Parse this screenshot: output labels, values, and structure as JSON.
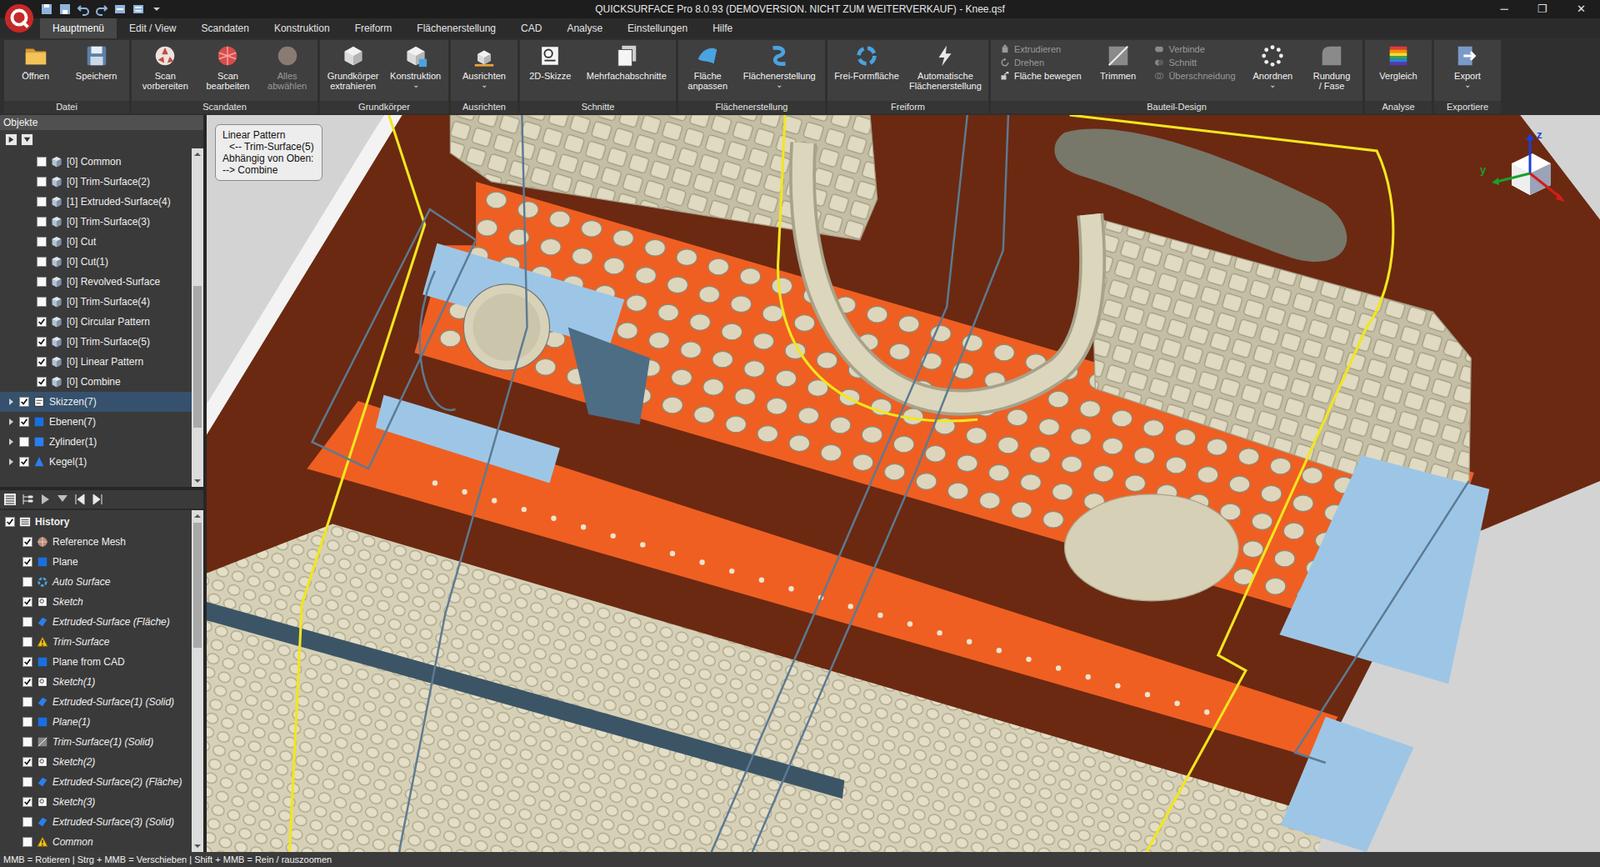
{
  "window": {
    "title": "QUICKSURFACE Pro 8.0.93 (DEMOVERSION. NICHT ZUM WEITERVERKAUF) - Knee.qsf",
    "controls": [
      "─",
      "❐",
      "✕"
    ]
  },
  "menu": [
    {
      "label": "Hauptmenü",
      "selected": true
    },
    {
      "label": "Edit / View",
      "selected": false
    },
    {
      "label": "Scandaten",
      "selected": false
    },
    {
      "label": "Konstruktion",
      "selected": false
    },
    {
      "label": "Freiform",
      "selected": false
    },
    {
      "label": "Flächenerstellung",
      "selected": false
    },
    {
      "label": "CAD",
      "selected": false
    },
    {
      "label": "Analyse",
      "selected": false
    },
    {
      "label": "Einstellungen",
      "selected": false
    },
    {
      "label": "Hilfe",
      "selected": false
    }
  ],
  "ribbon": [
    {
      "label": "Datei",
      "items": [
        {
          "kind": "large",
          "label": [
            "Öffnen"
          ],
          "disabled": false
        },
        {
          "kind": "large",
          "label": [
            "Speichern"
          ],
          "disabled": false
        }
      ]
    },
    {
      "label": "Scandaten",
      "items": [
        {
          "kind": "large",
          "label": [
            "Scan",
            "vorbereiten"
          ],
          "disabled": false
        },
        {
          "kind": "large",
          "label": [
            "Scan",
            "bearbeiten"
          ],
          "disabled": false
        },
        {
          "kind": "large",
          "label": [
            "Alles",
            "abwählen"
          ],
          "disabled": true
        }
      ]
    },
    {
      "label": "Grundkörper",
      "items": [
        {
          "kind": "large",
          "label": [
            "Grundkörper",
            "extrahieren"
          ],
          "disabled": false
        },
        {
          "kind": "large",
          "label": [
            "Konstruktion"
          ],
          "disabled": false,
          "arrow": "⌄"
        }
      ]
    },
    {
      "label": "Ausrichten",
      "items": [
        {
          "kind": "large",
          "label": [
            "Ausrichten"
          ],
          "disabled": false,
          "arrow": "⌄"
        }
      ]
    },
    {
      "label": "Schnitte",
      "items": [
        {
          "kind": "large",
          "label": [
            "2D-Skizze"
          ],
          "disabled": false
        },
        {
          "kind": "large",
          "label": [
            "Mehrfachabschnitte"
          ],
          "disabled": false
        }
      ]
    },
    {
      "label": "Flächenerstellung",
      "items": [
        {
          "kind": "large",
          "label": [
            "Fläche",
            "anpassen"
          ],
          "disabled": false
        },
        {
          "kind": "large",
          "label": [
            "Flächenerstellung"
          ],
          "disabled": false,
          "arrow": "⌄"
        }
      ]
    },
    {
      "label": "Freiform",
      "items": [
        {
          "kind": "large",
          "label": [
            "Frei-Formfläche"
          ],
          "disabled": false
        },
        {
          "kind": "large",
          "label": [
            "Automatische",
            "Flächenerstellung"
          ],
          "disabled": false
        }
      ]
    },
    {
      "label": "Bauteil-Design",
      "items": [
        {
          "kind": "stack",
          "items": [
            {
              "label": "Extrudieren",
              "disabled": true
            },
            {
              "label": "Drehen",
              "disabled": true
            },
            {
              "label": "Fläche bewegen",
              "disabled": false
            }
          ]
        },
        {
          "kind": "large",
          "label": [
            "Trimmen"
          ],
          "disabled": false
        },
        {
          "kind": "stack",
          "items": [
            {
              "label": "Verbinde",
              "disabled": true
            },
            {
              "label": "Schnitt",
              "disabled": true
            },
            {
              "label": "Überschneidung",
              "disabled": true
            }
          ]
        },
        {
          "kind": "large",
          "label": [
            "Anordnen"
          ],
          "disabled": false,
          "arrow": "⌄"
        },
        {
          "kind": "large",
          "label": [
            "Rundung",
            "/ Fase"
          ],
          "disabled": false
        }
      ]
    },
    {
      "label": "Analyse",
      "items": [
        {
          "kind": "large",
          "label": [
            "Vergleich"
          ],
          "disabled": false
        }
      ]
    },
    {
      "label": "Exportiere",
      "items": [
        {
          "kind": "large",
          "label": [
            "Export"
          ],
          "disabled": false,
          "arrow": "⌄"
        }
      ]
    }
  ],
  "objects": {
    "header": "Objekte",
    "items": [
      {
        "label": "[0] Common",
        "kind": "solid",
        "checked": false,
        "selected": false
      },
      {
        "label": "[0] Trim-Surface(2)",
        "kind": "solid",
        "checked": false,
        "selected": false
      },
      {
        "label": "[1] Extruded-Surface(4)",
        "kind": "solid",
        "checked": false,
        "selected": false
      },
      {
        "label": "[0] Trim-Surface(3)",
        "kind": "solid",
        "checked": false,
        "selected": false
      },
      {
        "label": "[0] Cut",
        "kind": "solid",
        "checked": false,
        "selected": false
      },
      {
        "label": "[0] Cut(1)",
        "kind": "solid",
        "checked": false,
        "selected": false
      },
      {
        "label": "[0] Revolved-Surface",
        "kind": "solid",
        "checked": false,
        "selected": false
      },
      {
        "label": "[0] Trim-Surface(4)",
        "kind": "solid",
        "checked": false,
        "selected": false
      },
      {
        "label": "[0] Circular Pattern",
        "kind": "solid",
        "checked": true,
        "selected": false
      },
      {
        "label": "[0] Trim-Surface(5)",
        "kind": "solid",
        "checked": true,
        "selected": false
      },
      {
        "label": "[0] Linear Pattern",
        "kind": "solid",
        "checked": true,
        "selected": false
      },
      {
        "label": "[0] Combine",
        "kind": "solid",
        "checked": true,
        "selected": false
      },
      {
        "label": "Skizzen(7)",
        "kind": "sketches",
        "checked": true,
        "selected": true,
        "expanded": false
      },
      {
        "label": "Ebenen(7)",
        "kind": "planes",
        "checked": true,
        "selected": false,
        "expanded": false
      },
      {
        "label": "Zylinder(1)",
        "kind": "cylinders",
        "checked": false,
        "selected": false,
        "expanded": false
      },
      {
        "label": "Kegel(1)",
        "kind": "cones",
        "checked": true,
        "selected": false,
        "expanded": false
      }
    ]
  },
  "history": {
    "items": [
      {
        "label": "History",
        "kind": "root",
        "checked": true,
        "italic": false
      },
      {
        "label": "Reference Mesh",
        "kind": "mesh",
        "checked": true,
        "italic": false
      },
      {
        "label": "Plane",
        "kind": "plane",
        "checked": true,
        "italic": false
      },
      {
        "label": "Auto Surface",
        "kind": "auto",
        "checked": false,
        "italic": true
      },
      {
        "label": "Sketch",
        "kind": "sketch",
        "checked": true,
        "italic": true
      },
      {
        "label": "Extruded-Surface (Fläche)",
        "kind": "extrude",
        "checked": false,
        "italic": true
      },
      {
        "label": "Trim-Surface",
        "kind": "warning",
        "checked": false,
        "italic": true
      },
      {
        "label": "Plane from CAD",
        "kind": "plane",
        "checked": true,
        "italic": false
      },
      {
        "label": "Sketch(1)",
        "kind": "sketch",
        "checked": true,
        "italic": true
      },
      {
        "label": "Extruded-Surface(1) (Solid)",
        "kind": "extrude",
        "checked": false,
        "italic": true
      },
      {
        "label": "Plane(1)",
        "kind": "plane",
        "checked": false,
        "italic": true
      },
      {
        "label": "Trim-Surface(1) (Solid)",
        "kind": "trim",
        "checked": false,
        "italic": true
      },
      {
        "label": "Sketch(2)",
        "kind": "sketch",
        "checked": true,
        "italic": true
      },
      {
        "label": "Extruded-Surface(2) (Fläche)",
        "kind": "extrude",
        "checked": false,
        "italic": true
      },
      {
        "label": "Sketch(3)",
        "kind": "sketch",
        "checked": true,
        "italic": true
      },
      {
        "label": "Extruded-Surface(3) (Solid)",
        "kind": "extrude",
        "checked": false,
        "italic": true
      },
      {
        "label": "Common",
        "kind": "warning",
        "checked": false,
        "italic": true
      }
    ]
  },
  "viewport": {
    "info": [
      "Linear Pattern",
      "<-- Trim-Surface(5)",
      "Abhängig von Oben:",
      "--> Combine"
    ],
    "axes": [
      {
        "label": "z",
        "color": "#1c3fd6"
      },
      {
        "label": "y",
        "color": "#17a02c"
      }
    ]
  },
  "status_bar": "MMB = Rotieren | Strg + MMB = Verschieben | Shift + MMB = Rein / rauszoomen"
}
